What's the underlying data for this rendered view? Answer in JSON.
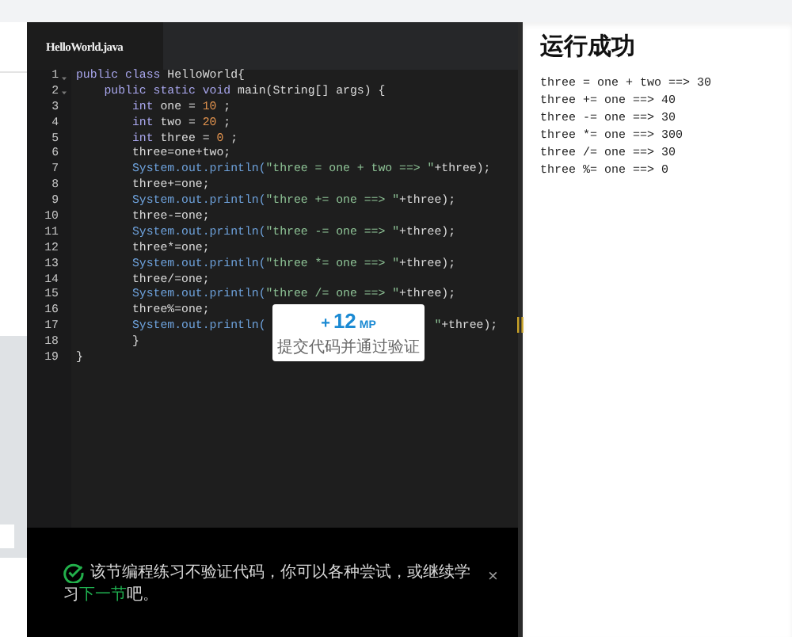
{
  "editor": {
    "tab": {
      "label": "HelloWorld.java",
      "selected": true
    },
    "lines": [
      {
        "number": "1",
        "fold": true,
        "tokens": [
          {
            "kind": "keyword",
            "text": "public class "
          },
          {
            "kind": "plain",
            "text": "HelloWorld{"
          }
        ]
      },
      {
        "number": "2",
        "fold": true,
        "tokens": [
          {
            "kind": "keyword",
            "text": "    public static void "
          },
          {
            "kind": "plain",
            "text": "main(String[] args) {"
          }
        ]
      },
      {
        "number": "3",
        "fold": false,
        "tokens": [
          {
            "kind": "keyword",
            "text": "        int "
          },
          {
            "kind": "plain",
            "text": "one = "
          },
          {
            "kind": "number",
            "text": "10"
          },
          {
            "kind": "plain",
            "text": " ;"
          }
        ]
      },
      {
        "number": "4",
        "fold": false,
        "tokens": [
          {
            "kind": "keyword",
            "text": "        int "
          },
          {
            "kind": "plain",
            "text": "two = "
          },
          {
            "kind": "number",
            "text": "20"
          },
          {
            "kind": "plain",
            "text": " ;"
          }
        ]
      },
      {
        "number": "5",
        "fold": false,
        "tokens": [
          {
            "kind": "keyword",
            "text": "        int "
          },
          {
            "kind": "plain",
            "text": "three = "
          },
          {
            "kind": "number",
            "text": "0"
          },
          {
            "kind": "plain",
            "text": " ;"
          }
        ]
      },
      {
        "number": "6",
        "fold": false,
        "tokens": [
          {
            "kind": "plain",
            "text": "        three=one+two;"
          }
        ]
      },
      {
        "number": "7",
        "fold": false,
        "tokens": [
          {
            "kind": "call",
            "text": "        System.out.println("
          },
          {
            "kind": "string",
            "text": "\"three = one + two ==> \""
          },
          {
            "kind": "plain",
            "text": "+three);"
          }
        ]
      },
      {
        "number": "8",
        "fold": false,
        "tokens": [
          {
            "kind": "plain",
            "text": "        three+=one;"
          }
        ]
      },
      {
        "number": "9",
        "fold": false,
        "tokens": [
          {
            "kind": "call",
            "text": "        System.out.println("
          },
          {
            "kind": "string",
            "text": "\"three += one ==> \""
          },
          {
            "kind": "plain",
            "text": "+three);"
          }
        ]
      },
      {
        "number": "10",
        "fold": false,
        "tokens": [
          {
            "kind": "plain",
            "text": "        three-=one;"
          }
        ]
      },
      {
        "number": "11",
        "fold": false,
        "tokens": [
          {
            "kind": "call",
            "text": "        System.out.println("
          },
          {
            "kind": "string",
            "text": "\"three -= one ==> \""
          },
          {
            "kind": "plain",
            "text": "+three);"
          }
        ]
      },
      {
        "number": "12",
        "fold": false,
        "tokens": [
          {
            "kind": "plain",
            "text": "        three*=one;"
          }
        ]
      },
      {
        "number": "13",
        "fold": false,
        "tokens": [
          {
            "kind": "call",
            "text": "        System.out.println("
          },
          {
            "kind": "string",
            "text": "\"three *= one ==> \""
          },
          {
            "kind": "plain",
            "text": "+three);"
          }
        ]
      },
      {
        "number": "14",
        "fold": false,
        "tokens": [
          {
            "kind": "plain",
            "text": "        three/=one;"
          }
        ]
      },
      {
        "number": "15",
        "fold": false,
        "tokens": [
          {
            "kind": "call",
            "text": "        System.out.println("
          },
          {
            "kind": "string",
            "text": "\"three /= one ==> \""
          },
          {
            "kind": "plain",
            "text": "+three);"
          }
        ]
      },
      {
        "number": "16",
        "fold": false,
        "tokens": [
          {
            "kind": "plain",
            "text": "        three%=one;"
          }
        ]
      },
      {
        "number": "17",
        "fold": false,
        "tokens": [
          {
            "kind": "call",
            "text": "        System.out.println("
          }
        ],
        "tail": [
          {
            "kind": "string",
            "text": "\""
          },
          {
            "kind": "plain",
            "text": "+three);"
          }
        ]
      },
      {
        "number": "18",
        "fold": false,
        "tokens": [
          {
            "kind": "plain",
            "text": "        }"
          }
        ]
      },
      {
        "number": "19",
        "fold": false,
        "tokens": [
          {
            "kind": "plain",
            "text": "}"
          }
        ]
      }
    ],
    "reward": {
      "plus": "+",
      "points": "12",
      "unit": "MP",
      "caption": "提交代码并通过验证"
    }
  },
  "notice": {
    "before": "该节编程练习不验证代码，你可以各种尝试，或继续学习",
    "link": "下一节",
    "after": "吧。",
    "close": "×"
  },
  "output": {
    "title": "运行成功",
    "lines": [
      "three = one + two ==> 30",
      "three += one ==> 40",
      "three -= one ==> 30",
      "three *= one ==> 300",
      "three /= one ==> 30",
      "three %= one ==> 0"
    ]
  }
}
